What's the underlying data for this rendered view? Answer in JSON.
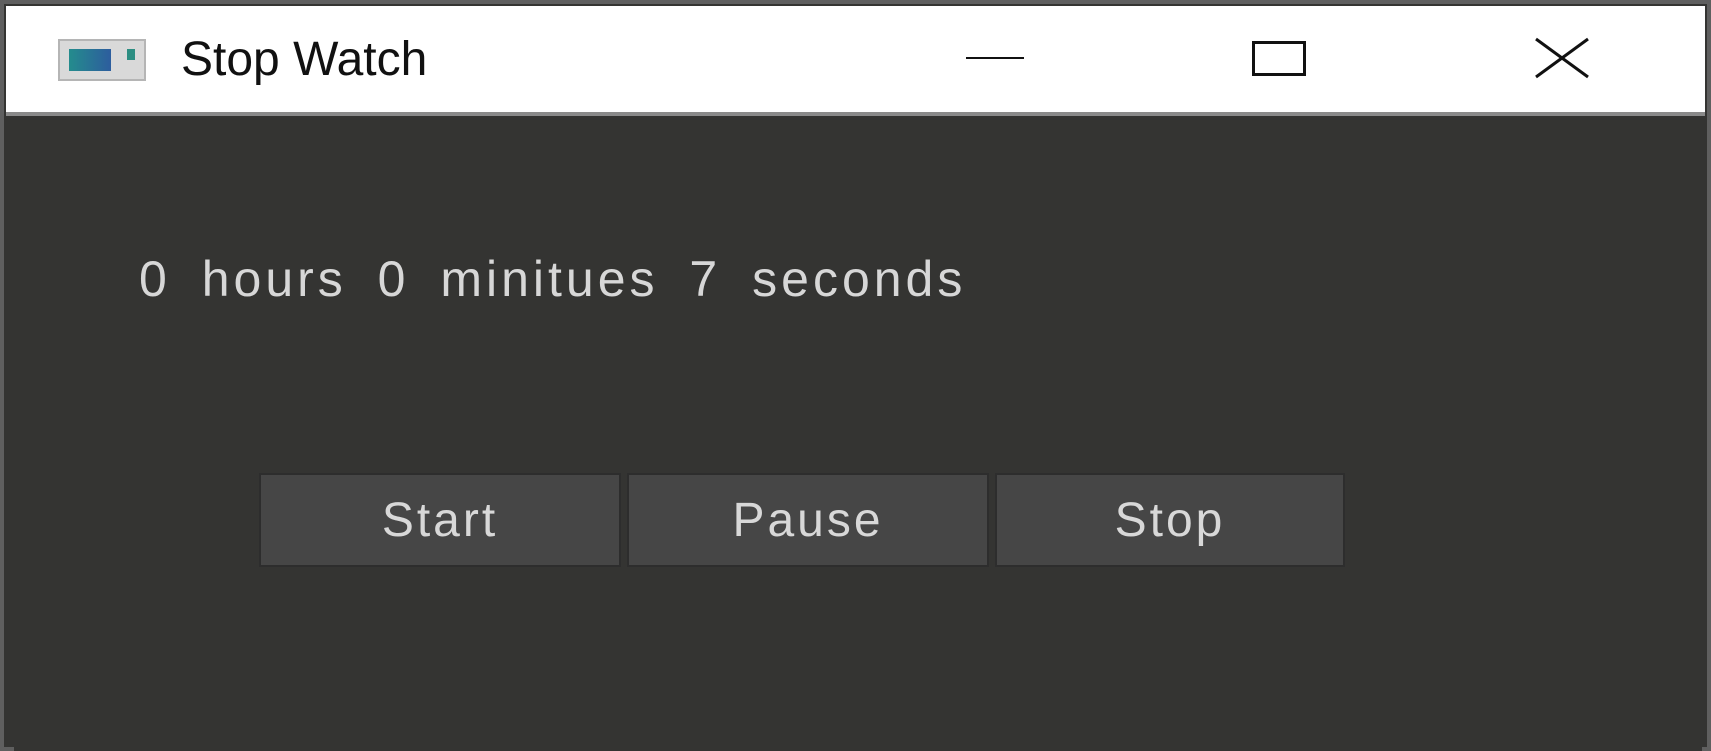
{
  "window": {
    "title": "Stop Watch",
    "controls": {
      "minimize_icon": "minimize-icon",
      "maximize_icon": "maximize-icon",
      "close_icon": "close-icon"
    }
  },
  "stopwatch": {
    "display_text": "0 hours 0 minitues 7 seconds",
    "buttons": {
      "start_label": "Start",
      "pause_label": "Pause",
      "stop_label": "Stop"
    }
  },
  "colors": {
    "titlebar": "#ffffff",
    "window_background": "#343432",
    "button_background": "#464646",
    "text_light": "#d7d7d7"
  }
}
